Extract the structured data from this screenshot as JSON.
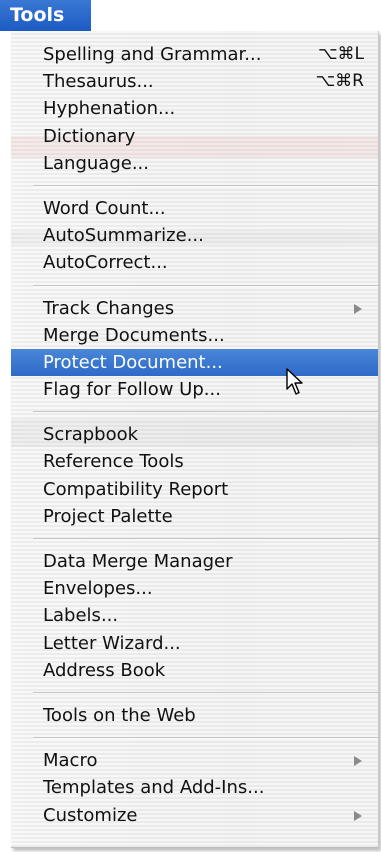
{
  "menu": {
    "title": "Tools",
    "groups": [
      [
        {
          "label": "Spelling and Grammar...",
          "shortcut": "⌥⌘L"
        },
        {
          "label": "Thesaurus...",
          "shortcut": "⌥⌘R"
        },
        {
          "label": "Hyphenation..."
        },
        {
          "label": "Dictionary"
        },
        {
          "label": "Language..."
        }
      ],
      [
        {
          "label": "Word Count..."
        },
        {
          "label": "AutoSummarize..."
        },
        {
          "label": "AutoCorrect..."
        }
      ],
      [
        {
          "label": "Track Changes",
          "submenu": true
        },
        {
          "label": "Merge Documents..."
        },
        {
          "label": "Protect Document...",
          "highlighted": true
        },
        {
          "label": "Flag for Follow Up..."
        }
      ],
      [
        {
          "label": "Scrapbook"
        },
        {
          "label": "Reference Tools"
        },
        {
          "label": "Compatibility Report"
        },
        {
          "label": "Project Palette"
        }
      ],
      [
        {
          "label": "Data Merge Manager"
        },
        {
          "label": "Envelopes..."
        },
        {
          "label": "Labels..."
        },
        {
          "label": "Letter Wizard..."
        },
        {
          "label": "Address Book"
        }
      ],
      [
        {
          "label": "Tools on the Web"
        }
      ],
      [
        {
          "label": "Macro",
          "submenu": true
        },
        {
          "label": "Templates and Add-Ins..."
        },
        {
          "label": "Customize",
          "submenu": true
        }
      ]
    ]
  },
  "cursor": {
    "icon": "arrow-pointer-icon"
  },
  "colors": {
    "highlight": "#3a74d0",
    "menu_title_bg": "#2a67cb"
  }
}
